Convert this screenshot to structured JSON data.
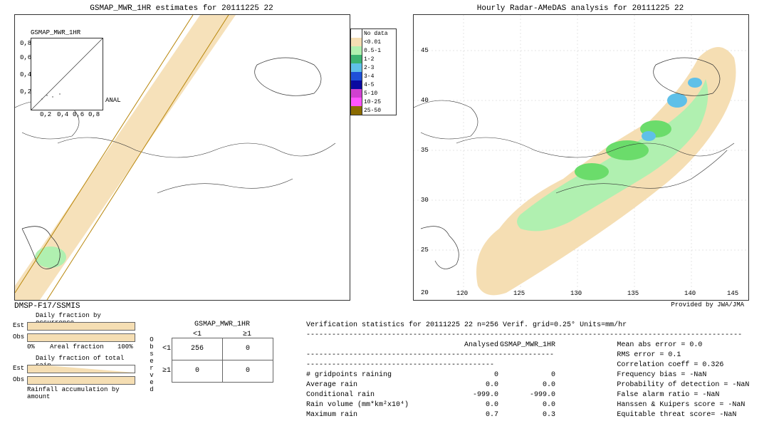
{
  "left_map": {
    "title": "GSMAP_MWR_1HR estimates for 20111225 22",
    "inset_title": "GSMAP_MWR_1HR",
    "inset_anal": "ANAL",
    "inset_axis": {
      "tx0": "0,2",
      "tx1": "0,4",
      "tx2": "0,6",
      "tx3": "0,8",
      "ty0": "0,2",
      "ty1": "0,4",
      "ty2": "0,6",
      "ty3": "0,8"
    },
    "provider": "DMSP-F17/SSMIS"
  },
  "right_map": {
    "title": "Hourly Radar-AMeDAS analysis for 20111225 22",
    "provided_by": "Provided by JWA/JMA",
    "xticks": [
      "120",
      "125",
      "130",
      "135",
      "140",
      "145"
    ],
    "yticks": [
      "45",
      "40",
      "35",
      "30",
      "25",
      "20"
    ],
    "xunit": " ",
    "yunit": " "
  },
  "legend": [
    {
      "label": "No data",
      "color": "#ffffff"
    },
    {
      "label": "<0.01",
      "color": "#f5deb3"
    },
    {
      "label": "0.5-1",
      "color": "#b0f0b0"
    },
    {
      "label": "1-2",
      "color": "#3cb371"
    },
    {
      "label": "2-3",
      "color": "#5fc0e8"
    },
    {
      "label": "3-4",
      "color": "#1e50d8"
    },
    {
      "label": "4-5",
      "color": "#0a0aa0"
    },
    {
      "label": "5-10",
      "color": "#d040d0"
    },
    {
      "label": "10-25",
      "color": "#ff55ff"
    },
    {
      "label": "25-50",
      "color": "#8b6b00"
    }
  ],
  "occurrence": {
    "title": "Daily fraction by occurrence",
    "est_label": "Est",
    "obs_label": "Obs",
    "x0": "0%",
    "x1": "100%",
    "xlabel": "Areal fraction"
  },
  "totalrain": {
    "title": "Daily fraction of total rain",
    "est_label": "Est",
    "obs_label": "Obs",
    "bottom": "Rainfall accumulation by amount"
  },
  "contingency": {
    "title": "GSMAP_MWR_1HR",
    "col_lt1": "<1",
    "col_ge1": "≥1",
    "row_lt1": "<1",
    "row_ge1": "≥1",
    "observed": "Observed",
    "cells": {
      "a": "256",
      "b": "0",
      "c": "0",
      "d": "0"
    }
  },
  "stats": {
    "header": "Verification statistics for 20111225 22  n=256  Verif. grid=0.25°  Units=mm/hr",
    "divider": "------------------------------------------------------------------------------------------------------",
    "col_analysed": "Analysed",
    "col_gsmap": "GSMAP_MWR_1HR",
    "rows_left": [
      {
        "label": "# gridpoints raining",
        "a": "0",
        "b": "0"
      },
      {
        "label": "Average rain",
        "a": "0.0",
        "b": "0.0"
      },
      {
        "label": "Conditional rain",
        "a": "-999.0",
        "b": "-999.0"
      },
      {
        "label": "Rain volume (mm*km²x10⁴)",
        "a": "0.0",
        "b": "0.0"
      },
      {
        "label": "Maximum rain",
        "a": "0.7",
        "b": "0.3"
      }
    ],
    "rows_right": [
      "Mean abs error = 0.0",
      "RMS error = 0.1",
      "Correlation coeff = 0.326",
      "Frequency bias = -NaN",
      "Probability of detection = -NaN",
      "False alarm ratio = -NaN",
      "Hanssen & Kuipers score = -NaN",
      "Equitable threat score= -NaN"
    ]
  },
  "chart_data": {
    "type": "comparison-maps",
    "title_left": "GSMAP_MWR_1HR estimates for 20111225 22",
    "title_right": "Hourly Radar-AMeDAS analysis for 20111225 22",
    "region_lon": [
      120,
      150
    ],
    "region_lat": [
      20,
      48
    ],
    "units": "mm/hr",
    "palette_bins": [
      "No data",
      "<0.01",
      "0.5-1",
      "1-2",
      "2-3",
      "3-4",
      "4-5",
      "5-10",
      "10-25",
      "25-50"
    ],
    "contingency": {
      "observed_lt1_est_lt1": 256,
      "observed_lt1_est_ge1": 0,
      "observed_ge1_est_lt1": 0,
      "observed_ge1_est_ge1": 0
    },
    "verification": {
      "n": 256,
      "grid_deg": 0.25,
      "gridpoints_raining_analysed": 0,
      "gridpoints_raining_gsmap": 0,
      "avg_rain_analysed": 0.0,
      "avg_rain_gsmap": 0.0,
      "cond_rain_analysed": -999.0,
      "cond_rain_gsmap": -999.0,
      "rain_volume_analysed": 0.0,
      "rain_volume_gsmap": 0.0,
      "max_rain_analysed": 0.7,
      "max_rain_gsmap": 0.3,
      "mean_abs_error": 0.0,
      "rms_error": 0.1,
      "correlation": 0.326,
      "frequency_bias": "NaN",
      "pod": "NaN",
      "far": "NaN",
      "hk": "NaN",
      "ets": "NaN"
    },
    "daily_fraction_occurrence_est": 1.0,
    "daily_fraction_occurrence_obs": 1.0,
    "daily_fraction_total_rain_est": [
      0.18,
      1.0
    ],
    "daily_fraction_total_rain_obs": 1.0
  }
}
